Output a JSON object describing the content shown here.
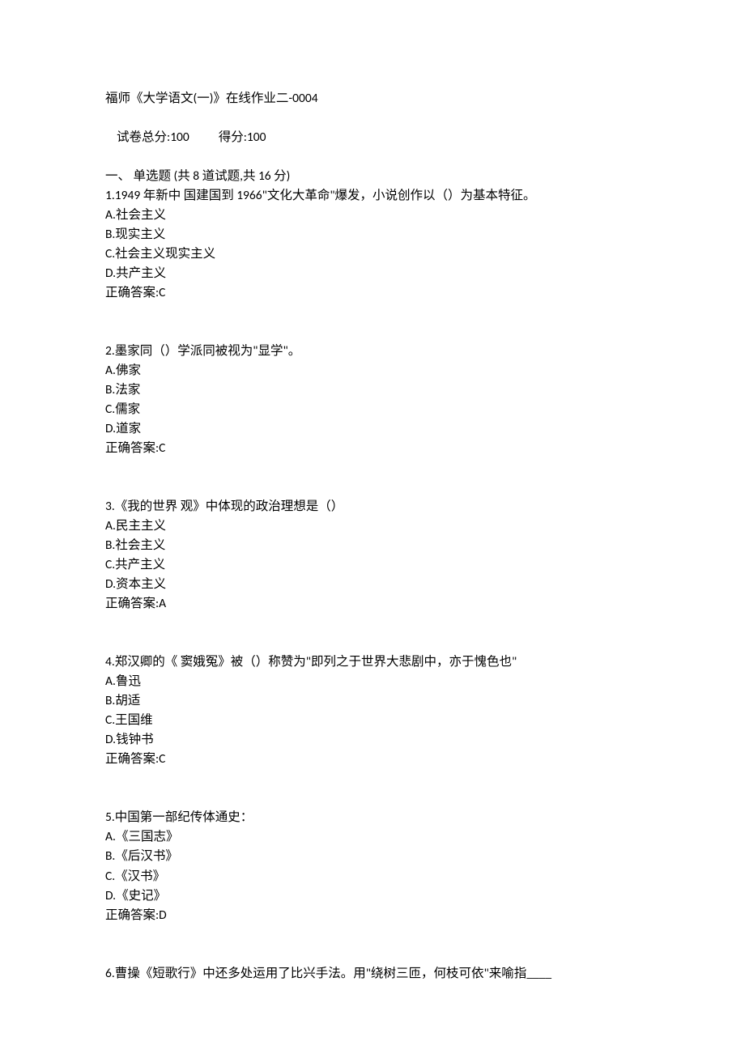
{
  "header": {
    "title": "福师《大学语文(一)》在线作业二-0004",
    "total_label": "试卷总分:",
    "total_value": "100",
    "score_label": "得分:",
    "score_value": "100",
    "section_label": "一、 单选题 (共 8 道试题,共 16 分)"
  },
  "questions": [
    {
      "stem": "1.1949 年新中 国建国到 1966\"文化大革命\"爆发，小说创作以（）为基本特征。",
      "opts": [
        "A.社会主义",
        "B.现实主义",
        "C.社会主义现实主义",
        "D.共产主义"
      ],
      "answer": "正确答案:C"
    },
    {
      "stem": "2.墨家同（）学派同被视为\"显学\"。",
      "opts": [
        "A.佛家",
        "B.法家",
        "C.儒家",
        "D.道家"
      ],
      "answer": "正确答案:C"
    },
    {
      "stem": "3.《我的世界 观》中体现的政治理想是（）",
      "opts": [
        "A.民主主义",
        "B.社会主义",
        "C.共产主义",
        "D.资本主义"
      ],
      "answer": "正确答案:A"
    },
    {
      "stem": "4.郑汉卿的《 窦娥冤》被（）称赞为\"即列之于世界大悲剧中，亦于愧色也\"",
      "opts": [
        "A.鲁迅",
        "B.胡适",
        "C.王国维",
        "D.钱钟书"
      ],
      "answer": "正确答案:C"
    },
    {
      "stem": "5.中国第一部纪传体通史：",
      "opts": [
        "A.《三国志》",
        "B.《后汉书》",
        "C.《汉书》",
        "D.《史记》"
      ],
      "answer": "正确答案:D"
    },
    {
      "stem": "6.曹操《短歌行》中还多处运用了比兴手法。用\"绕树三匝，何枝可依\"来喻指____",
      "opts": [],
      "answer": ""
    }
  ]
}
